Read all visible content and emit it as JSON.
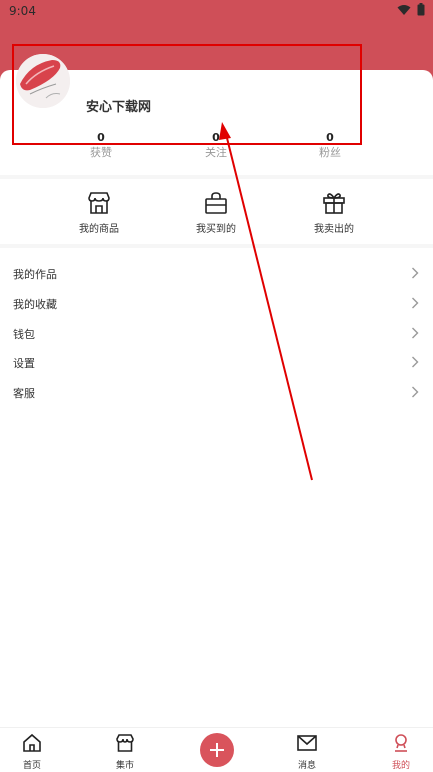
{
  "status": {
    "time": "9:04"
  },
  "profile": {
    "username": "安心下载网"
  },
  "stats": [
    {
      "count": "0",
      "label": "获赞"
    },
    {
      "count": "0",
      "label": "关注"
    },
    {
      "count": "0",
      "label": "粉丝"
    }
  ],
  "quick_actions": [
    {
      "label": "我的商品",
      "icon": "store-icon"
    },
    {
      "label": "我买到的",
      "icon": "shopping-bag-icon"
    },
    {
      "label": "我卖出的",
      "icon": "gift-icon"
    }
  ],
  "menu": [
    {
      "label": "我的作品"
    },
    {
      "label": "我的收藏"
    },
    {
      "label": "钱包"
    },
    {
      "label": "设置"
    },
    {
      "label": "客服"
    }
  ],
  "tabs": [
    {
      "label": "首页",
      "icon": "home-icon"
    },
    {
      "label": "集市",
      "icon": "market-icon"
    },
    {
      "label": "消息",
      "icon": "mail-icon"
    },
    {
      "label": "我的",
      "icon": "profile-icon"
    }
  ],
  "colors": {
    "accent": "#cf4f58",
    "annotation": "#e00000"
  }
}
